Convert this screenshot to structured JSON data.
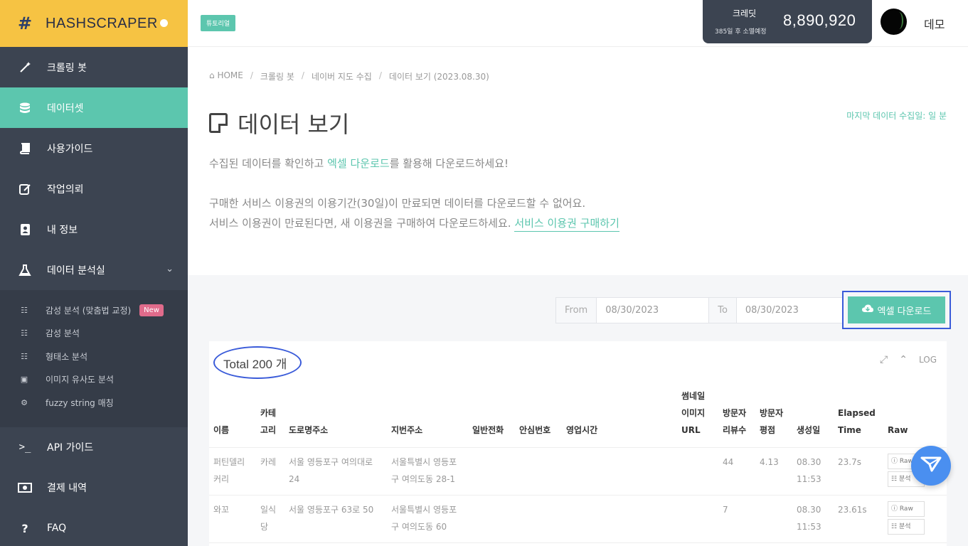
{
  "brand": {
    "name": "HASHSCRAPER"
  },
  "sidebar": {
    "items": [
      {
        "label": "크롤링 봇",
        "icon": "magic-wand-icon"
      },
      {
        "label": "데이터셋",
        "icon": "database-icon"
      },
      {
        "label": "사용가이드",
        "icon": "book-icon"
      },
      {
        "label": "작업의뢰",
        "icon": "edit-icon"
      },
      {
        "label": "내 정보",
        "icon": "user-card-icon"
      },
      {
        "label": "데이터 분석실",
        "icon": "flask-icon"
      }
    ],
    "sub_items": [
      {
        "label": "감성 분석 (맞춤법 교정)",
        "badge": "New"
      },
      {
        "label": "감성 분석"
      },
      {
        "label": "형태소 분석"
      },
      {
        "label": "이미지 유사도 분석"
      },
      {
        "label": "fuzzy string 매칭"
      }
    ],
    "bottom_items": [
      {
        "label": "API 가이드",
        "icon": "terminal-icon"
      },
      {
        "label": "결제 내역",
        "icon": "money-icon"
      },
      {
        "label": "FAQ",
        "icon": "question-icon"
      }
    ]
  },
  "topbar": {
    "tutorial": "튜토리얼",
    "credit_label": "크레딧",
    "credit_sub": "385일 후 소멸예정",
    "credit_value": "8,890,920",
    "user_name": "데모"
  },
  "breadcrumb": [
    "HOME",
    "크롤링 봇",
    "네이버 지도 수집",
    "데이터 보기 (2023.08.30)"
  ],
  "page": {
    "title": "데이터 보기",
    "last_collected": "마지막 데이터 수집일: 일 분",
    "desc1_pre": "수집된 데이터를 확인하고 ",
    "desc1_link": "엑셀 다운로드",
    "desc1_post": "를 활용해 다운로드하세요!",
    "desc2": "구매한 서비스 이용권의 이용기간(30일)이 만료되면 데이터를 다운로드할 수 없어요.",
    "desc3_pre": "서비스 이용권이 만료된다면, 새 이용권을 구매하여 다운로드하세요. ",
    "desc3_link": "서비스 이용권 구매하기"
  },
  "filter": {
    "from_label": "From",
    "from_value": "08/30/2023",
    "to_label": "To",
    "to_value": "08/30/2023",
    "excel_button": "엑셀 다운로드"
  },
  "table": {
    "total": "Total 200 개",
    "log": "LOG",
    "headers": [
      "이름",
      "카테고리",
      "도로명주소",
      "지번주소",
      "일반전화",
      "안심번호",
      "영업시간",
      "썸네일이미지URL",
      "방문자리뷰수",
      "방문자평점",
      "생성일",
      "Elapsed Time",
      "Raw"
    ],
    "header_lines": [
      [
        "이름"
      ],
      [
        "카테",
        "고리"
      ],
      [
        "도로명주소"
      ],
      [
        "지번주소"
      ],
      [
        "일반전화"
      ],
      [
        "안심번호"
      ],
      [
        "영업시간"
      ],
      [
        "썸네일",
        "이미지",
        "URL"
      ],
      [
        "방문자",
        "리뷰수"
      ],
      [
        "방문자",
        "평점"
      ],
      [
        "생성일"
      ],
      [
        "Elapsed",
        "Time"
      ],
      [
        "Raw"
      ]
    ],
    "rows": [
      {
        "name": "퍼틴델리커리",
        "name_lines": [
          "퍼틴델리",
          "커리"
        ],
        "category_lines": [
          "카레"
        ],
        "road_lines": [
          "서울 영등포구 여의대로",
          "24"
        ],
        "lot_lines": [
          "서울특별시 영등포",
          "구 여의도동 28-1"
        ],
        "phone": "",
        "safe": "",
        "hours": "",
        "thumb": "",
        "reviews": "44",
        "rating": "4.13",
        "created_lines": [
          "08.30",
          "11:53"
        ],
        "elapsed": "23.7s",
        "raw": "Raw",
        "analysis": "분석"
      },
      {
        "name": "와꼬",
        "name_lines": [
          "와꼬"
        ],
        "category_lines": [
          "일식",
          "당"
        ],
        "road_lines": [
          "서울 영등포구 63로 50"
        ],
        "lot_lines": [
          "서울특별시 영등포",
          "구 여의도동 60"
        ],
        "phone": "",
        "safe": "",
        "hours": "",
        "thumb": "",
        "reviews": "7",
        "rating": "",
        "created_lines": [
          "08.30",
          "11:53"
        ],
        "elapsed": "23.61s",
        "raw": "Raw",
        "analysis": "분석"
      }
    ]
  },
  "colors": {
    "accent": "#5cc6ae",
    "sidebar": "#3c4451",
    "brand": "#f6c343",
    "annotation": "#3a5bd9",
    "fab": "#4a8ff0"
  }
}
